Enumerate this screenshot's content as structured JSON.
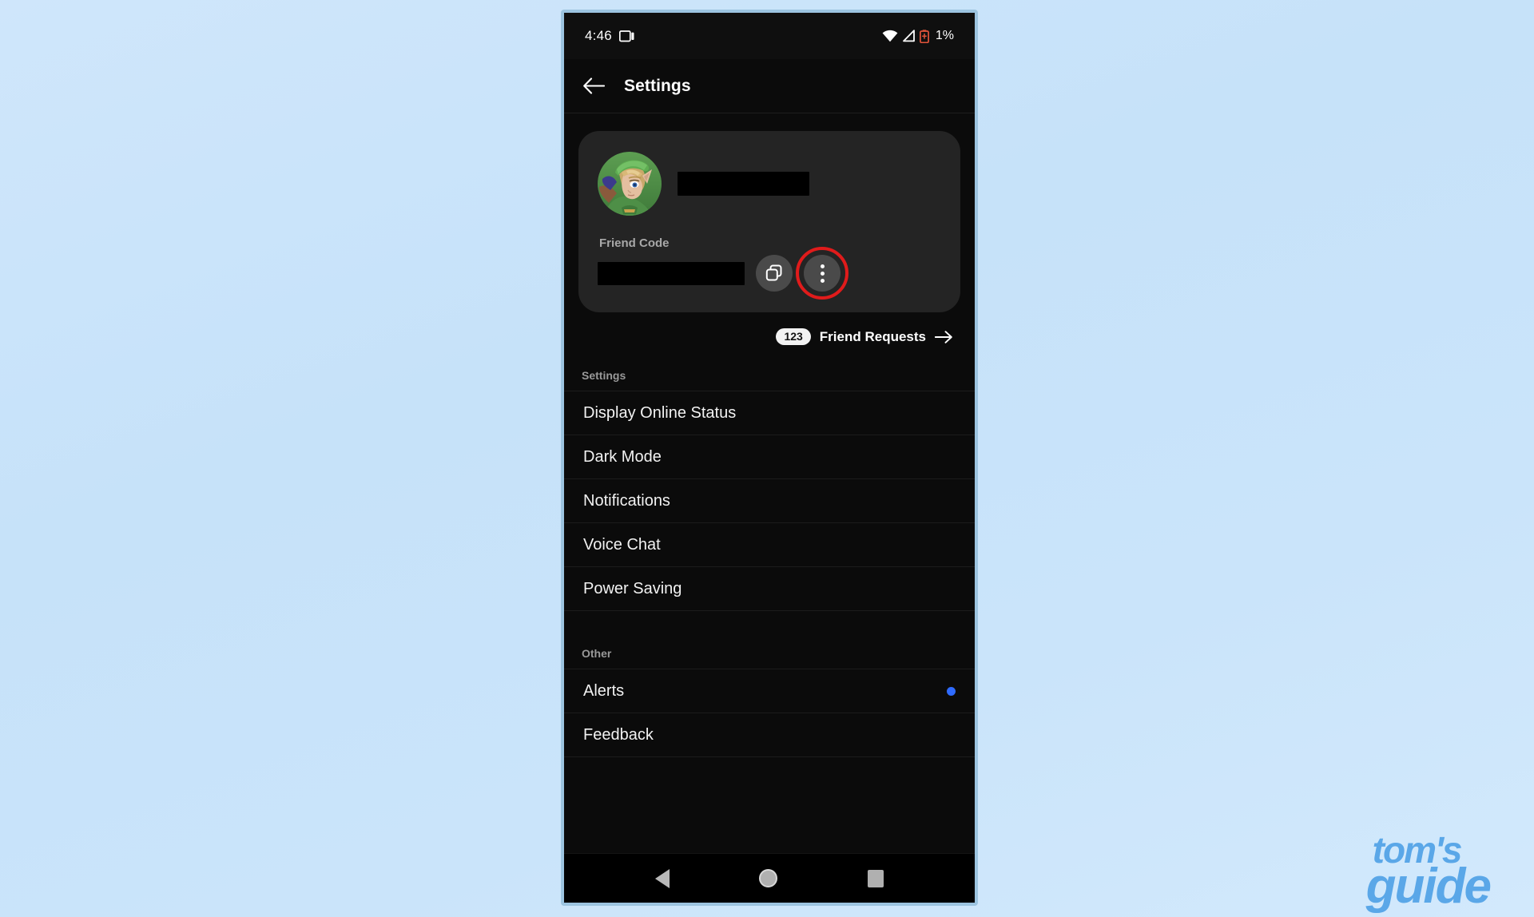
{
  "background": {
    "color": "#c6e2f9"
  },
  "watermark": {
    "line1": "tom's",
    "line2": "guide",
    "color": "#5aa7e8"
  },
  "phone": {
    "frame_color": "#9cc4e0",
    "status_bar": {
      "time": "4:46",
      "cast_icon": "cast-screen-icon",
      "wifi_icon": "wifi-icon",
      "signal_icon": "cellular-signal-icon",
      "battery_icon": "battery-low-icon",
      "battery_color": "#e0533a",
      "battery_percent": "1%"
    },
    "app_bar": {
      "back_icon": "back-arrow-icon",
      "title": "Settings"
    },
    "profile_card": {
      "avatar_icon": "user-avatar-link",
      "username_redacted": "",
      "friend_code_label": "Friend Code",
      "friend_code_redacted": "",
      "copy_icon": "copy-icon",
      "menu_icon": "more-vertical-icon",
      "highlight_color": "#e01b1b"
    },
    "friend_requests": {
      "count": "123",
      "label": "Friend Requests",
      "arrow_icon": "arrow-right-icon"
    },
    "sections": [
      {
        "header": "Settings",
        "items": [
          {
            "label": "Display Online Status",
            "dot": false
          },
          {
            "label": "Dark Mode",
            "dot": false
          },
          {
            "label": "Notifications",
            "dot": false
          },
          {
            "label": "Voice Chat",
            "dot": false
          },
          {
            "label": "Power Saving",
            "dot": false
          }
        ]
      },
      {
        "header": "Other",
        "items": [
          {
            "label": "Alerts",
            "dot": true,
            "dot_color": "#2f6bff"
          },
          {
            "label": "Feedback",
            "dot": false
          }
        ]
      }
    ],
    "nav_bar": {
      "back_icon": "nav-back-triangle-icon",
      "home_icon": "nav-home-circle-icon",
      "recents_icon": "nav-recents-square-icon"
    }
  }
}
